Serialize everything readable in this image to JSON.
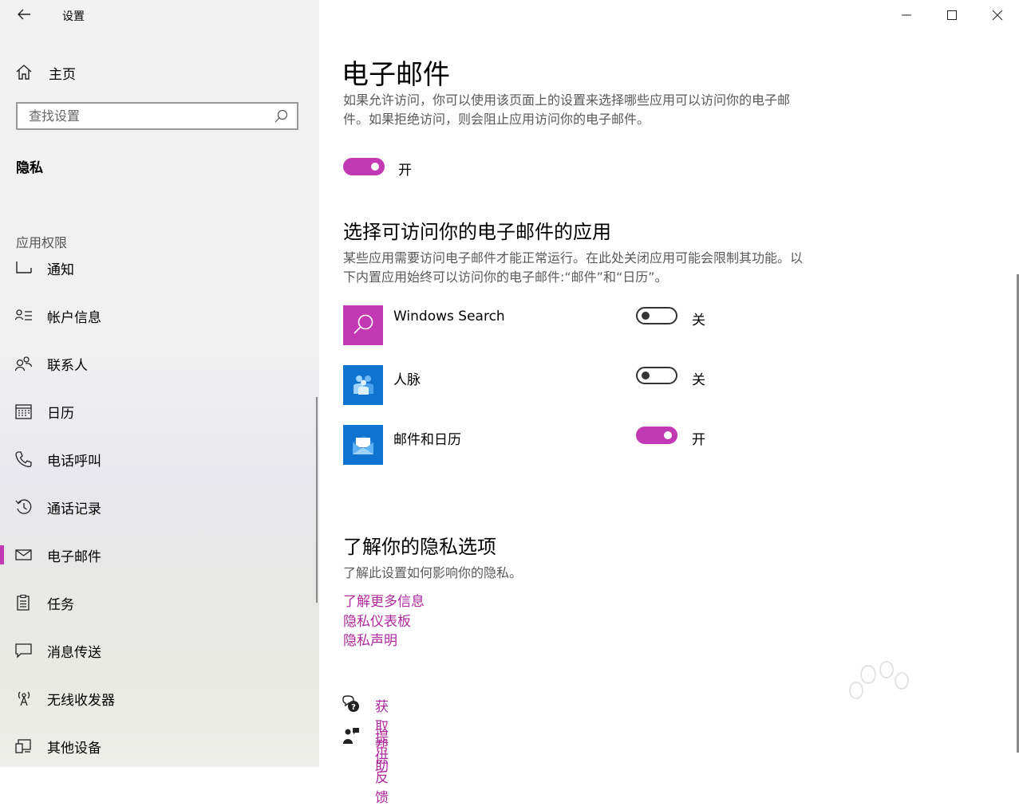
{
  "window": {
    "title": "设置"
  },
  "sidebar": {
    "home_label": "主页",
    "search_placeholder": "查找设置",
    "section": "隐私",
    "group_label": "应用权限",
    "items": [
      {
        "label": "通知",
        "icon": "notification-icon"
      },
      {
        "label": "帐户信息",
        "icon": "account-info-icon"
      },
      {
        "label": "联系人",
        "icon": "contacts-icon"
      },
      {
        "label": "日历",
        "icon": "calendar-icon"
      },
      {
        "label": "电话呼叫",
        "icon": "phone-icon"
      },
      {
        "label": "通话记录",
        "icon": "call-history-icon"
      },
      {
        "label": "电子邮件",
        "icon": "mail-icon",
        "selected": true
      },
      {
        "label": "任务",
        "icon": "tasks-icon"
      },
      {
        "label": "消息传送",
        "icon": "message-icon"
      },
      {
        "label": "无线收发器",
        "icon": "radio-icon"
      },
      {
        "label": "其他设备",
        "icon": "other-devices-icon"
      }
    ]
  },
  "main": {
    "title": "电子邮件",
    "intro": "如果允许访问，你可以使用该页面上的设置来选择哪些应用可以访问你的电子邮件。如果拒绝访问，则会阻止应用访问你的电子邮件。",
    "master_toggle": {
      "state": "on",
      "label": "开"
    },
    "apps_heading": "选择可访问你的电子邮件的应用",
    "apps_desc": "某些应用需要访问电子邮件才能正常运行。在此处关闭应用可能会限制其功能。以下内置应用始终可以访问你的电子邮件:“邮件”和“日历”。",
    "apps": [
      {
        "name": "Windows Search",
        "state": "off",
        "state_label": "关",
        "icon": "search-app-icon",
        "tile_color": "#c239b3"
      },
      {
        "name": "人脉",
        "state": "off",
        "state_label": "关",
        "icon": "people-app-icon",
        "tile_color": "#0f74d0"
      },
      {
        "name": "邮件和日历",
        "state": "on",
        "state_label": "开",
        "icon": "mail-calendar-app-icon",
        "tile_color": "#0f74d0"
      }
    ],
    "privacy_heading": "了解你的隐私选项",
    "privacy_desc": "了解此设置如何影响你的隐私。",
    "links": [
      "了解更多信息",
      "隐私仪表板",
      "隐私声明"
    ],
    "help": {
      "get_help": "获取帮助",
      "feedback": "提供反馈"
    }
  },
  "colors": {
    "accent": "#c239b3",
    "link": "#b0289e",
    "sidebar_bg": "#f2f2f2"
  }
}
